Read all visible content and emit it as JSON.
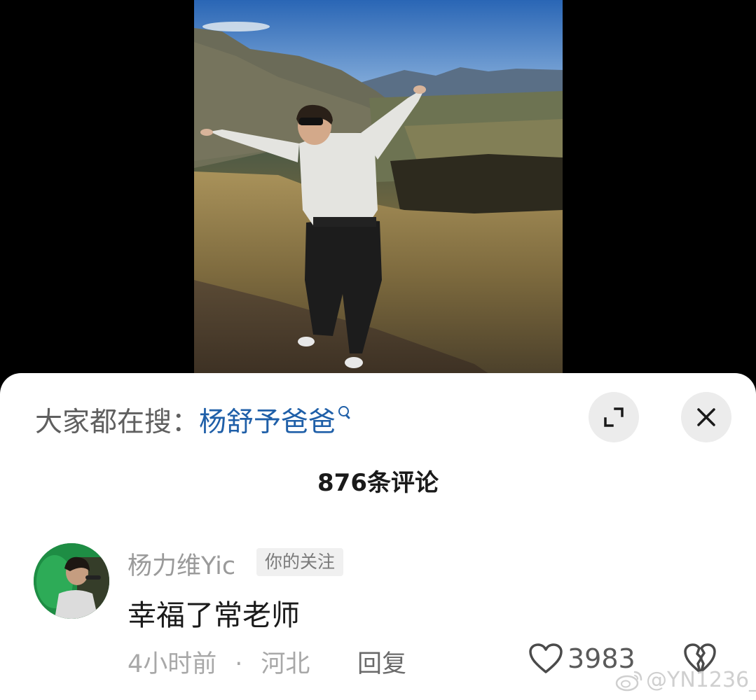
{
  "search": {
    "prefix": "大家都在搜：",
    "term": "杨舒予爸爸"
  },
  "comments": {
    "count_label": "876条评论",
    "items": [
      {
        "username": "杨力维Yic",
        "tag": "你的关注",
        "text": "幸福了常老师",
        "time": "4小时前",
        "separator": "·",
        "location": "河北",
        "reply_label": "回复",
        "likes": "3983"
      }
    ]
  },
  "watermark": "@YN1236_",
  "icons": {
    "expand": "expand-icon",
    "close": "close-icon",
    "search": "search-icon",
    "like": "heart-outline-icon",
    "dislike": "broken-heart-icon",
    "watermark": "weibo-logo-icon",
    "more": "more-dots-icon"
  },
  "colors": {
    "search_term": "#1f5fa8",
    "sheet_background": "#ffffff",
    "backdrop": "#000000"
  }
}
